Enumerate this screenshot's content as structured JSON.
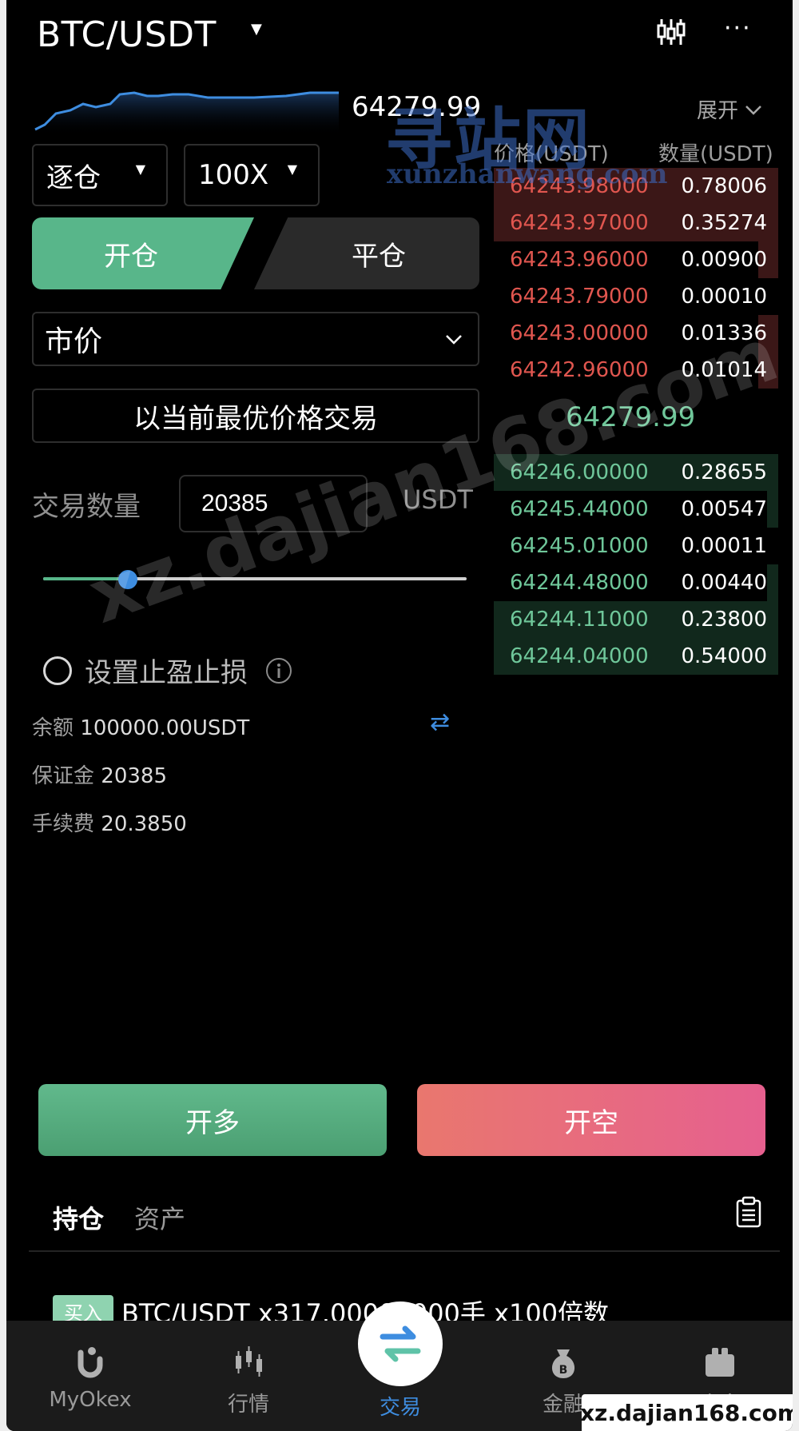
{
  "header": {
    "pair": "BTC/USDT",
    "kline_icon": "candlestick-icon",
    "more_icon": "more-icon"
  },
  "mini_chart": {
    "last_price": "64279.99",
    "line_color": "#3e8de0"
  },
  "controls": {
    "margin_mode": "逐仓",
    "leverage": "100X",
    "tab_open": "开仓",
    "tab_close": "平仓",
    "price_type": "市价",
    "best_price_hint": "以当前最优价格交易",
    "qty_label": "交易数量",
    "qty_value": "20385",
    "qty_unit": "USDT",
    "slider_fraction": 0.2,
    "tpsl_label": "设置止盈止损"
  },
  "account": {
    "balance_label": "余额",
    "balance_value": "100000.00USDT",
    "margin_label": "保证金",
    "margin_value": "20385",
    "fee_label": "手续费",
    "fee_value": "20.3850"
  },
  "orderbook": {
    "expand_label": "展开",
    "price_header": "价格(USDT)",
    "qty_header": "数量(USDT)",
    "asks": [
      {
        "price": "64243.98000",
        "qty": "0.78006",
        "depth": 1.0
      },
      {
        "price": "64243.97000",
        "qty": "0.35274",
        "depth": 1.0
      },
      {
        "price": "64243.96000",
        "qty": "0.00900",
        "depth": 0.07
      },
      {
        "price": "64243.79000",
        "qty": "0.00010",
        "depth": 0.0
      },
      {
        "price": "64243.00000",
        "qty": "0.01336",
        "depth": 0.07
      },
      {
        "price": "64242.96000",
        "qty": "0.01014",
        "depth": 0.07
      }
    ],
    "mid_price": "64279.99",
    "bids": [
      {
        "price": "64246.00000",
        "qty": "0.28655",
        "depth": 1.0
      },
      {
        "price": "64245.44000",
        "qty": "0.00547",
        "depth": 0.04
      },
      {
        "price": "64245.01000",
        "qty": "0.00011",
        "depth": 0.0
      },
      {
        "price": "64244.48000",
        "qty": "0.00440",
        "depth": 0.04
      },
      {
        "price": "64244.11000",
        "qty": "0.23800",
        "depth": 1.0
      },
      {
        "price": "64244.04000",
        "qty": "0.54000",
        "depth": 1.0
      }
    ]
  },
  "actions": {
    "long": "开多",
    "short": "开空"
  },
  "positions": {
    "tab_positions": "持仓",
    "tab_assets": "资产",
    "badge": "买入",
    "summary": "BTC/USDT x317.00000000手 x100倍数"
  },
  "nav": {
    "items": [
      {
        "label": "MyOkex",
        "icon": "profile-icon"
      },
      {
        "label": "行情",
        "icon": "market-icon"
      },
      {
        "label": "交易",
        "icon": "trade-swap-icon"
      },
      {
        "label": "金融",
        "icon": "finance-bag-icon"
      },
      {
        "label": "资产",
        "icon": "assets-icon"
      }
    ]
  },
  "watermarks": {
    "diagonal": "xz.dajian168.com",
    "logo_cn": "寻站网",
    "logo_en": "xunzhanwang.com",
    "corner": "xz.dajian168.com"
  },
  "colors": {
    "green": "#58b68a",
    "red": "#e0564f",
    "accent": "#3e8de0",
    "background": "#000000"
  }
}
